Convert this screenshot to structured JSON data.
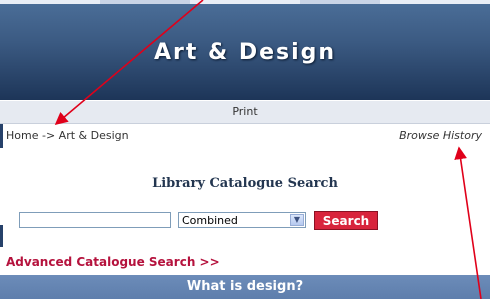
{
  "banner": {
    "title": "Art & Design"
  },
  "toolbar": {
    "print_label": "Print"
  },
  "breadcrumb": {
    "home": "Home",
    "separator": "->",
    "current": "Art & Design"
  },
  "history": {
    "browse_label": "Browse History"
  },
  "search": {
    "title": "Library Catalogue Search",
    "input_value": "",
    "scope_selected": "Combined",
    "button_label": "Search",
    "advanced_label": "Advanced Catalogue Search >>"
  },
  "section": {
    "title": "What is design?"
  },
  "colors": {
    "banner": "#1d3558",
    "accent_red": "#d8243c",
    "link_red": "#b5123d",
    "annotation_arrow": "#e0001a"
  }
}
